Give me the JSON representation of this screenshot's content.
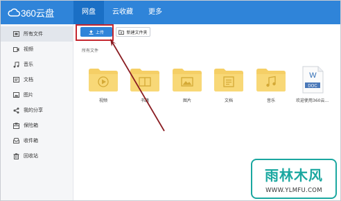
{
  "app": {
    "logo_text": "360云盘"
  },
  "nav": {
    "items": [
      {
        "label": "网盘",
        "active": true
      },
      {
        "label": "云收藏",
        "active": false
      },
      {
        "label": "更多",
        "active": false
      }
    ]
  },
  "sidebar": {
    "items": [
      {
        "label": "所有文件",
        "icon": "all-files-icon",
        "active": true
      },
      {
        "label": "视频",
        "icon": "video-icon",
        "active": false
      },
      {
        "label": "音乐",
        "icon": "music-icon",
        "active": false
      },
      {
        "label": "文档",
        "icon": "document-icon",
        "active": false
      },
      {
        "label": "图片",
        "icon": "image-icon",
        "active": false
      },
      {
        "label": "我的分享",
        "icon": "share-icon",
        "active": false
      },
      {
        "label": "保险箱",
        "icon": "safe-box-icon",
        "active": false
      },
      {
        "label": "收件箱",
        "icon": "inbox-icon",
        "active": false
      },
      {
        "label": "回收站",
        "icon": "recycle-bin-icon",
        "active": false
      }
    ]
  },
  "toolbar": {
    "upload_label": "上传",
    "new_folder_label": "新建文件夹"
  },
  "breadcrumb": {
    "current": "所有文件"
  },
  "files": [
    {
      "name": "视频",
      "type": "folder",
      "icon": "video-folder-icon"
    },
    {
      "name": "书籍",
      "type": "folder",
      "icon": "book-folder-icon"
    },
    {
      "name": "图片",
      "type": "folder",
      "icon": "image-folder-icon"
    },
    {
      "name": "文档",
      "type": "folder",
      "icon": "document-folder-icon"
    },
    {
      "name": "音乐",
      "type": "folder",
      "icon": "music-folder-icon"
    },
    {
      "name": "欢迎使用360云...",
      "type": "doc",
      "icon": "word-doc-icon",
      "badge": "DOC",
      "letter": "W"
    }
  ],
  "watermark": {
    "title": "雨林木风",
    "url": "WWW.YLMFU.COM"
  },
  "colors": {
    "brand_blue": "#2f84d9",
    "active_nav": "#1a6fc5",
    "folder_yellow": "#f5cf66",
    "annotation_red": "#c4262e",
    "watermark_teal": "#1aa7a0"
  }
}
